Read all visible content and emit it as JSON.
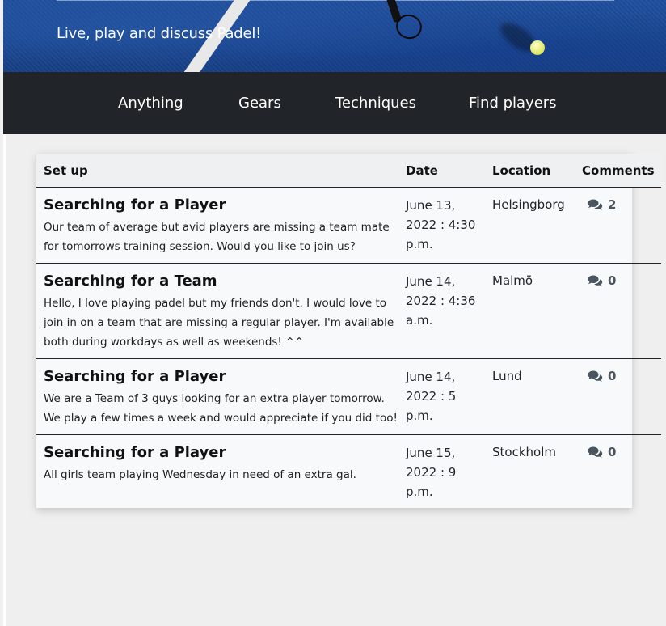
{
  "header": {
    "tagline": "Live, play and discuss Padel!"
  },
  "nav": {
    "items": [
      "Anything",
      "Gears",
      "Techniques",
      "Find players"
    ]
  },
  "table": {
    "columns": [
      "Set up",
      "Date",
      "Location",
      "Comments"
    ],
    "rows": [
      {
        "title": "Searching for a Player",
        "body": "Our team of average but avid players are missing a team mate for tomorrows training session. Would you like to join us?",
        "date": "June 13, 2022 : 4:30 p.m.",
        "location": "Helsingborg",
        "comments": "2"
      },
      {
        "title": "Searching for a Team",
        "body": "Hello, I love playing padel but my friends don't. I would love to join in on a team that are missing a regular player. I'm available both during workdays as well as weekends! ^^",
        "date": "June 14, 2022 : 4:36 a.m.",
        "location": "Malmö",
        "comments": "0"
      },
      {
        "title": "Searching for a Player",
        "body": "We are a Team of 3 guys looking for an extra player tomorrow. We play a few times a week and would appreciate if you did too!",
        "date": "June 14, 2022 : 5 p.m.",
        "location": "Lund",
        "comments": "0"
      },
      {
        "title": "Searching for a Player",
        "body": "All girls team playing Wednesday in need of an extra gal.",
        "date": "June 15, 2022 : 9 p.m.",
        "location": "Stockholm",
        "comments": "0"
      }
    ]
  },
  "icons": {
    "comment": "comments-icon"
  },
  "colors": {
    "nav_bg": "#212529",
    "hero_blue": "#1a4690",
    "table_bg": "#f8f9fa",
    "comment_icon": "#4a5560"
  }
}
